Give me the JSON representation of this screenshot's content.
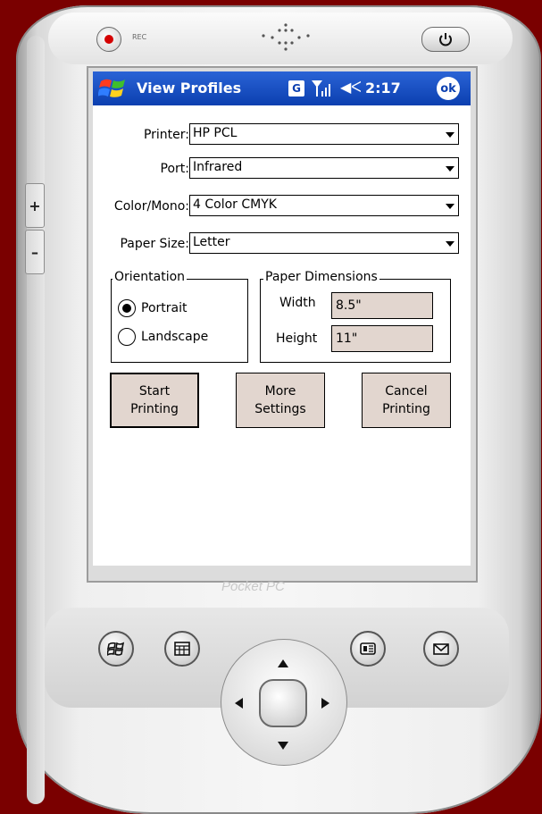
{
  "device": {
    "rec_label": "REC",
    "side_plus": "+",
    "side_minus": "–",
    "brand_logo": "Pocket PC",
    "hardware_buttons": [
      "windows-start-icon",
      "calendar-icon",
      "contacts-icon",
      "mail-icon"
    ],
    "colors": {
      "background": "#7a0000",
      "device_body": "#f0f0f0"
    }
  },
  "titlebar": {
    "title": "View Profiles",
    "g_badge": "G",
    "time": "2:17",
    "ok_label": "ok",
    "icons": [
      "windows-flag-icon",
      "signal-icon",
      "volume-icon"
    ],
    "colors": {
      "bar": "#0b3fb0",
      "text": "#ffffff"
    }
  },
  "form": {
    "printer": {
      "label": "Printer:",
      "value": "HP PCL"
    },
    "port": {
      "label": "Port:",
      "value": "Infrared"
    },
    "color_mono": {
      "label": "Color/Mono:",
      "value": "4 Color CMYK"
    },
    "paper_size": {
      "label": "Paper Size:",
      "value": "Letter"
    }
  },
  "orientation": {
    "legend": "Orientation",
    "options": [
      {
        "label": "Portrait",
        "selected": true
      },
      {
        "label": "Landscape",
        "selected": false
      }
    ]
  },
  "paper_dimensions": {
    "legend": "Paper Dimensions",
    "width_label": "Width",
    "width_value": "8.5\"",
    "height_label": "Height",
    "height_value": "11\""
  },
  "buttons": {
    "start": {
      "line1": "Start",
      "line2": "Printing"
    },
    "more": {
      "line1": "More",
      "line2": "Settings"
    },
    "cancel": {
      "line1": "Cancel",
      "line2": "Printing"
    },
    "field_color": "#e2d6cf"
  }
}
